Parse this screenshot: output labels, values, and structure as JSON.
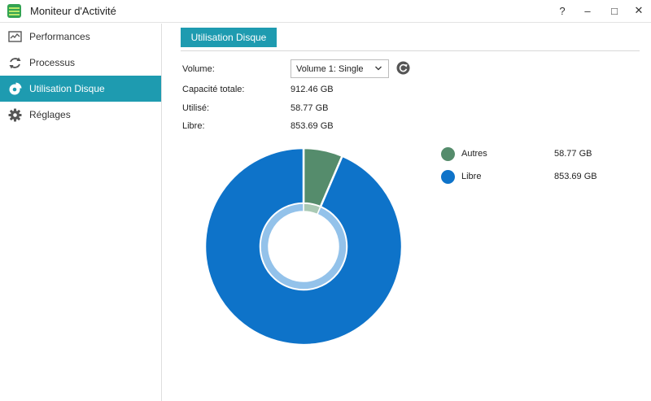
{
  "window": {
    "title": "Moniteur d'Activité",
    "help_glyph": "?",
    "minimize_glyph": "–",
    "maximize_glyph": "□",
    "close_glyph": "✕"
  },
  "sidebar": {
    "items": [
      {
        "label": "Performances",
        "icon": "performance-chart-icon",
        "active": false
      },
      {
        "label": "Processus",
        "icon": "refresh-cycle-icon",
        "active": false
      },
      {
        "label": "Utilisation Disque",
        "icon": "disk-usage-icon",
        "active": true
      },
      {
        "label": "Réglages",
        "icon": "gear-icon",
        "active": false
      }
    ]
  },
  "main": {
    "tab_label": "Utilisation Disque",
    "volume_label": "Volume:",
    "volume_selected": "Volume 1: Single",
    "capacity_label": "Capacité totale:",
    "capacity_value": "912.46 GB",
    "used_label": "Utilisé:",
    "used_value": "58.77 GB",
    "free_label": "Libre:",
    "free_value": "853.69 GB"
  },
  "colors": {
    "accent": "#1e9bb0",
    "autres": "#558c6c",
    "libre": "#0e73c9",
    "inner_ring": "#93c2ea"
  },
  "chart_data": {
    "type": "pie",
    "title": "",
    "series": [
      {
        "name": "Autres",
        "value": 58.77,
        "display": "58.77 GB"
      },
      {
        "name": "Libre",
        "value": 853.69,
        "display": "853.69 GB"
      }
    ],
    "legend_position": "right"
  }
}
